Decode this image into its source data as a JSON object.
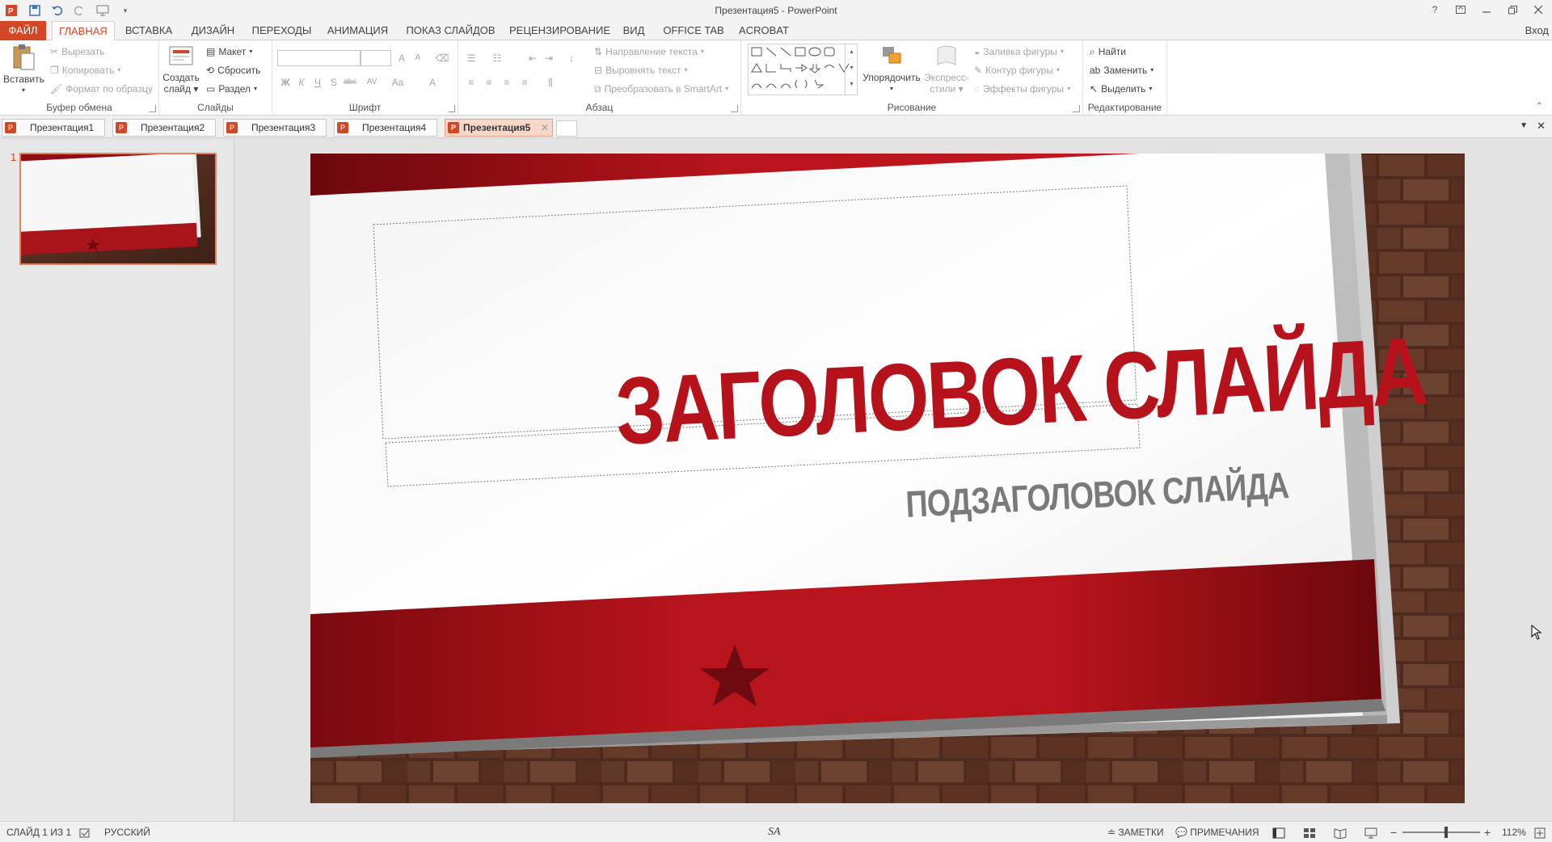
{
  "window": {
    "title": "Презентация5 - PowerPoint",
    "sign_in": "Вход",
    "help": "?"
  },
  "ribbon_tabs": [
    "ФАЙЛ",
    "ГЛАВНАЯ",
    "ВСТАВКА",
    "ДИЗАЙН",
    "ПЕРЕХОДЫ",
    "АНИМАЦИЯ",
    "ПОКАЗ СЛАЙДОВ",
    "РЕЦЕНЗИРОВАНИЕ",
    "ВИД",
    "OFFICE TAB",
    "ACROBAT"
  ],
  "clipboard": {
    "label": "Буфер обмена",
    "paste": "Вставить",
    "cut": "Вырезать",
    "copy": "Копировать",
    "format_painter": "Формат по образцу"
  },
  "slides_group": {
    "label": "Слайды",
    "new_slide_line1": "Создать",
    "new_slide_line2": "слайд",
    "layout": "Макет",
    "reset": "Сбросить",
    "section": "Раздел"
  },
  "font_group": {
    "label": "Шрифт",
    "bold": "Ж",
    "italic": "К",
    "underline": "Ч",
    "shadow": "S",
    "strike": "abc",
    "spacing": "AV",
    "case": "Aa",
    "color": "A"
  },
  "paragraph_group": {
    "label": "Абзац",
    "text_direction": "Направление текста",
    "align_text": "Выровнять текст",
    "smartart": "Преобразовать в SmartArt"
  },
  "drawing_group": {
    "label": "Рисование",
    "arrange": "Упорядочить",
    "quick_styles_line1": "Экспресс-",
    "quick_styles_line2": "стили",
    "shape_fill": "Заливка фигуры",
    "shape_outline": "Контур фигуры",
    "shape_effects": "Эффекты фигуры"
  },
  "editing_group": {
    "label": "Редактирование",
    "find": "Найти",
    "replace": "Заменить",
    "select": "Выделить"
  },
  "doc_tabs": [
    {
      "label": "Презентация1",
      "active": false
    },
    {
      "label": "Презентация2",
      "active": false
    },
    {
      "label": "Презентация3",
      "active": false
    },
    {
      "label": "Презентация4",
      "active": false
    },
    {
      "label": "Презентация5",
      "active": true
    }
  ],
  "thumbnail": {
    "number": "1"
  },
  "slide": {
    "title": "ЗАГОЛОВОК СЛАЙДА",
    "subtitle": "ПОДЗАГОЛОВОК СЛАЙДА"
  },
  "status": {
    "slide_of": "СЛАЙД 1 ИЗ 1",
    "language": "РУССКИЙ",
    "center_mark": "SA",
    "notes": "ЗАМЕТКИ",
    "comments": "ПРИМЕЧАНИЯ",
    "zoom": "112%",
    "zoom_fraction": 0.56
  },
  "colors": {
    "accent": "#d24726",
    "slide_red": "#b01218",
    "title_red": "#b5121b",
    "subtitle_gray": "#7a7a7a"
  }
}
